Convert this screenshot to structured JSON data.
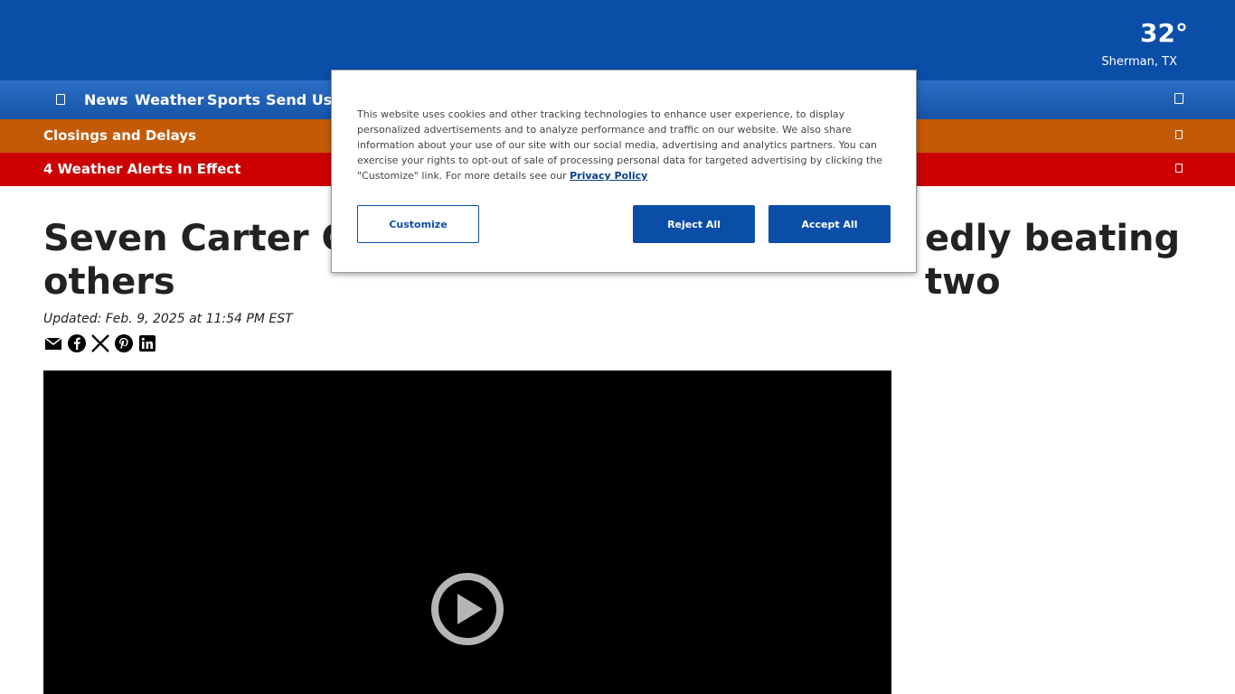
{
  "header": {
    "temperature": "32°",
    "location": "Sherman, TX"
  },
  "nav": {
    "items": [
      "News",
      "Weather",
      "Sports",
      "Send Us Y"
    ]
  },
  "alerts": {
    "closings": "Closings and Delays",
    "weather_alerts": "4 Weather Alerts In Effect"
  },
  "article": {
    "headline": "Seven Carter Cou",
    "headline_right": "edly beating two",
    "headline_line2": "others",
    "updated": "Updated: Feb. 9, 2025 at 11:54 PM EST"
  },
  "share_icons": [
    "email-icon",
    "facebook-icon",
    "x-icon",
    "pinterest-icon",
    "linkedin-icon"
  ],
  "cookie_modal": {
    "text": "This website uses cookies and other tracking technologies to enhance user experience, to display personalized advertisements and to analyze performance and traffic on our website. We also share information about your use of our site with our social media, advertising and analytics partners. You can exercise your rights to opt-out of sale of processing personal data for targeted advertising by clicking the \"Customize\" link. For more details see our",
    "privacy_link": "Privacy Policy",
    "customize": "Customize",
    "reject_all": "Reject All",
    "accept_all": "Accept All"
  },
  "colors": {
    "brand_blue": "#0b4ea8",
    "closings_orange": "#c55a06",
    "alert_red": "#cc0000"
  }
}
